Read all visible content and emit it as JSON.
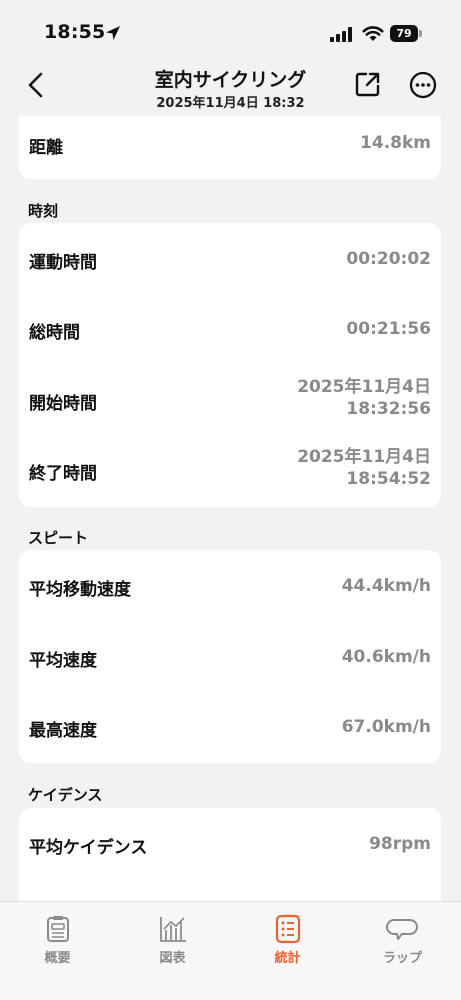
{
  "status_bar": {
    "time": "18:55",
    "battery": "79"
  },
  "header": {
    "title": "室内サイクリング",
    "subtitle": "2025年11月4日 18:32"
  },
  "partial_card": {
    "label": "距離",
    "value": "14.8km"
  },
  "sections": {
    "time": {
      "heading": "時刻",
      "rows": [
        {
          "label": "運動時間",
          "value": "00:20:02"
        },
        {
          "label": "総時間",
          "value": "00:21:56"
        },
        {
          "label": "開始時間",
          "value_line1": "2025年11月4日",
          "value_line2": "18:32:56"
        },
        {
          "label": "終了時間",
          "value_line1": "2025年11月4日",
          "value_line2": "18:54:52"
        }
      ]
    },
    "speed": {
      "heading": "スピート",
      "rows": [
        {
          "label": "平均移動速度",
          "value": "44.4km/h"
        },
        {
          "label": "平均速度",
          "value": "40.6km/h"
        },
        {
          "label": "最高速度",
          "value": "67.0km/h"
        }
      ]
    },
    "cadence": {
      "heading": "ケイデンス",
      "rows": [
        {
          "label": "平均ケイデンス",
          "value": "98rpm"
        }
      ]
    }
  },
  "tabs": [
    {
      "label": "概要",
      "icon": "summary-icon",
      "active": false
    },
    {
      "label": "図表",
      "icon": "chart-icon",
      "active": false
    },
    {
      "label": "統計",
      "icon": "stats-list-icon",
      "active": true
    },
    {
      "label": "ラップ",
      "icon": "lap-icon",
      "active": false
    }
  ],
  "colors": {
    "accent": "#f0622d",
    "background": "#f2f2f4",
    "card": "#ffffff",
    "value_text": "#8a8a8e"
  }
}
